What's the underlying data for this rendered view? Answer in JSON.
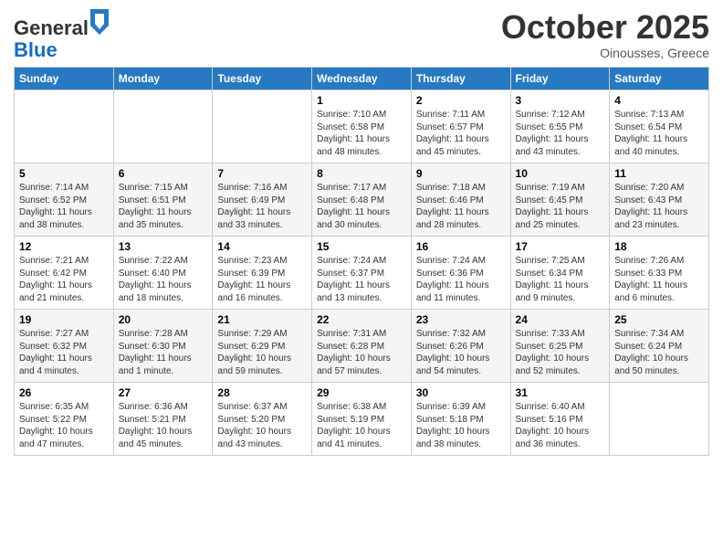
{
  "header": {
    "logo_general": "General",
    "logo_blue": "Blue",
    "month": "October 2025",
    "location": "Oinousses, Greece"
  },
  "weekdays": [
    "Sunday",
    "Monday",
    "Tuesday",
    "Wednesday",
    "Thursday",
    "Friday",
    "Saturday"
  ],
  "weeks": [
    [
      {
        "day": "",
        "info": ""
      },
      {
        "day": "",
        "info": ""
      },
      {
        "day": "",
        "info": ""
      },
      {
        "day": "1",
        "info": "Sunrise: 7:10 AM\nSunset: 6:58 PM\nDaylight: 11 hours\nand 48 minutes."
      },
      {
        "day": "2",
        "info": "Sunrise: 7:11 AM\nSunset: 6:57 PM\nDaylight: 11 hours\nand 45 minutes."
      },
      {
        "day": "3",
        "info": "Sunrise: 7:12 AM\nSunset: 6:55 PM\nDaylight: 11 hours\nand 43 minutes."
      },
      {
        "day": "4",
        "info": "Sunrise: 7:13 AM\nSunset: 6:54 PM\nDaylight: 11 hours\nand 40 minutes."
      }
    ],
    [
      {
        "day": "5",
        "info": "Sunrise: 7:14 AM\nSunset: 6:52 PM\nDaylight: 11 hours\nand 38 minutes."
      },
      {
        "day": "6",
        "info": "Sunrise: 7:15 AM\nSunset: 6:51 PM\nDaylight: 11 hours\nand 35 minutes."
      },
      {
        "day": "7",
        "info": "Sunrise: 7:16 AM\nSunset: 6:49 PM\nDaylight: 11 hours\nand 33 minutes."
      },
      {
        "day": "8",
        "info": "Sunrise: 7:17 AM\nSunset: 6:48 PM\nDaylight: 11 hours\nand 30 minutes."
      },
      {
        "day": "9",
        "info": "Sunrise: 7:18 AM\nSunset: 6:46 PM\nDaylight: 11 hours\nand 28 minutes."
      },
      {
        "day": "10",
        "info": "Sunrise: 7:19 AM\nSunset: 6:45 PM\nDaylight: 11 hours\nand 25 minutes."
      },
      {
        "day": "11",
        "info": "Sunrise: 7:20 AM\nSunset: 6:43 PM\nDaylight: 11 hours\nand 23 minutes."
      }
    ],
    [
      {
        "day": "12",
        "info": "Sunrise: 7:21 AM\nSunset: 6:42 PM\nDaylight: 11 hours\nand 21 minutes."
      },
      {
        "day": "13",
        "info": "Sunrise: 7:22 AM\nSunset: 6:40 PM\nDaylight: 11 hours\nand 18 minutes."
      },
      {
        "day": "14",
        "info": "Sunrise: 7:23 AM\nSunset: 6:39 PM\nDaylight: 11 hours\nand 16 minutes."
      },
      {
        "day": "15",
        "info": "Sunrise: 7:24 AM\nSunset: 6:37 PM\nDaylight: 11 hours\nand 13 minutes."
      },
      {
        "day": "16",
        "info": "Sunrise: 7:24 AM\nSunset: 6:36 PM\nDaylight: 11 hours\nand 11 minutes."
      },
      {
        "day": "17",
        "info": "Sunrise: 7:25 AM\nSunset: 6:34 PM\nDaylight: 11 hours\nand 9 minutes."
      },
      {
        "day": "18",
        "info": "Sunrise: 7:26 AM\nSunset: 6:33 PM\nDaylight: 11 hours\nand 6 minutes."
      }
    ],
    [
      {
        "day": "19",
        "info": "Sunrise: 7:27 AM\nSunset: 6:32 PM\nDaylight: 11 hours\nand 4 minutes."
      },
      {
        "day": "20",
        "info": "Sunrise: 7:28 AM\nSunset: 6:30 PM\nDaylight: 11 hours\nand 1 minute."
      },
      {
        "day": "21",
        "info": "Sunrise: 7:29 AM\nSunset: 6:29 PM\nDaylight: 10 hours\nand 59 minutes."
      },
      {
        "day": "22",
        "info": "Sunrise: 7:31 AM\nSunset: 6:28 PM\nDaylight: 10 hours\nand 57 minutes."
      },
      {
        "day": "23",
        "info": "Sunrise: 7:32 AM\nSunset: 6:26 PM\nDaylight: 10 hours\nand 54 minutes."
      },
      {
        "day": "24",
        "info": "Sunrise: 7:33 AM\nSunset: 6:25 PM\nDaylight: 10 hours\nand 52 minutes."
      },
      {
        "day": "25",
        "info": "Sunrise: 7:34 AM\nSunset: 6:24 PM\nDaylight: 10 hours\nand 50 minutes."
      }
    ],
    [
      {
        "day": "26",
        "info": "Sunrise: 6:35 AM\nSunset: 5:22 PM\nDaylight: 10 hours\nand 47 minutes."
      },
      {
        "day": "27",
        "info": "Sunrise: 6:36 AM\nSunset: 5:21 PM\nDaylight: 10 hours\nand 45 minutes."
      },
      {
        "day": "28",
        "info": "Sunrise: 6:37 AM\nSunset: 5:20 PM\nDaylight: 10 hours\nand 43 minutes."
      },
      {
        "day": "29",
        "info": "Sunrise: 6:38 AM\nSunset: 5:19 PM\nDaylight: 10 hours\nand 41 minutes."
      },
      {
        "day": "30",
        "info": "Sunrise: 6:39 AM\nSunset: 5:18 PM\nDaylight: 10 hours\nand 38 minutes."
      },
      {
        "day": "31",
        "info": "Sunrise: 6:40 AM\nSunset: 5:16 PM\nDaylight: 10 hours\nand 36 minutes."
      },
      {
        "day": "",
        "info": ""
      }
    ]
  ]
}
